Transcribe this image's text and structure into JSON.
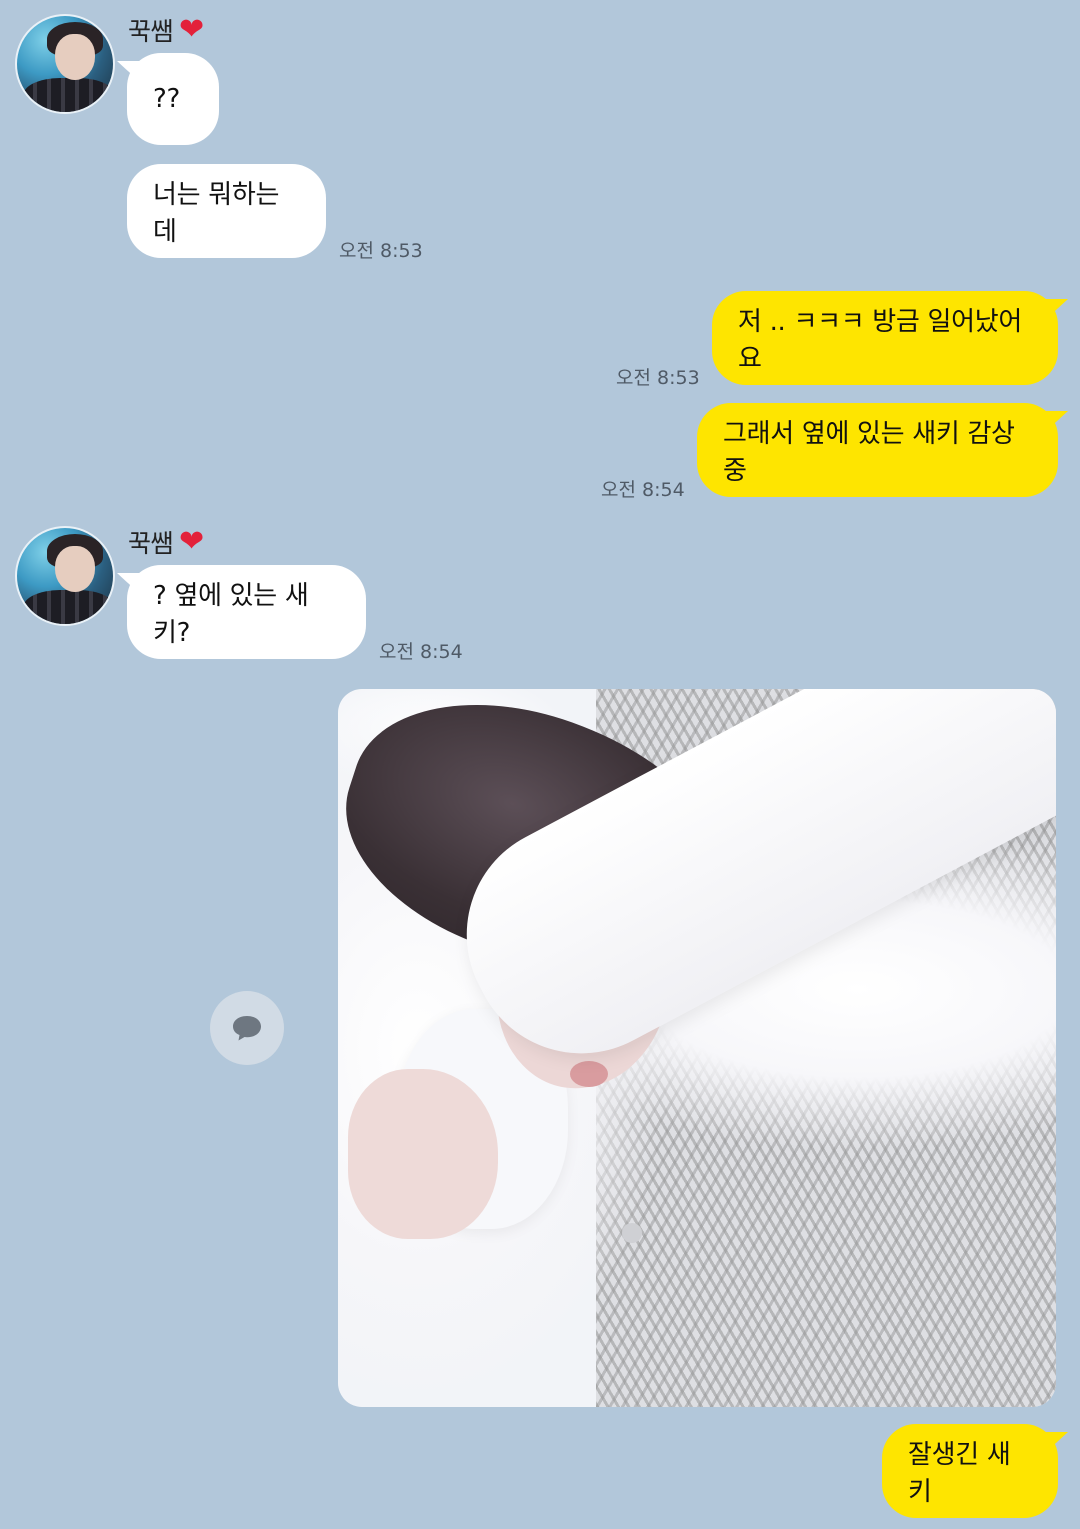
{
  "messages": {
    "m1": {
      "sender": "꾹쌤",
      "text": "??"
    },
    "m2": {
      "text": "너는 뭐하는데",
      "time": "오전 8:53"
    },
    "m3": {
      "text": "저 .. ㅋㅋㅋ 방금 일어났어요",
      "time": "오전 8:53"
    },
    "m4": {
      "text": "그래서 옆에 있는 새키 감상 중",
      "time": "오전 8:54"
    },
    "m5": {
      "sender": "꾹쌤",
      "text": "? 옆에 있는 새키?",
      "time": "오전 8:54"
    },
    "m7": {
      "text": "잘생긴 새키"
    }
  },
  "icons": {
    "heart": "heart-icon",
    "comment": "speech-bubble-icon",
    "heart_glyph": "❤"
  },
  "colors": {
    "background": "#b2c7da",
    "incoming_bubble": "#ffffff",
    "outgoing_bubble": "#fee500",
    "heart": "#e3213a"
  }
}
